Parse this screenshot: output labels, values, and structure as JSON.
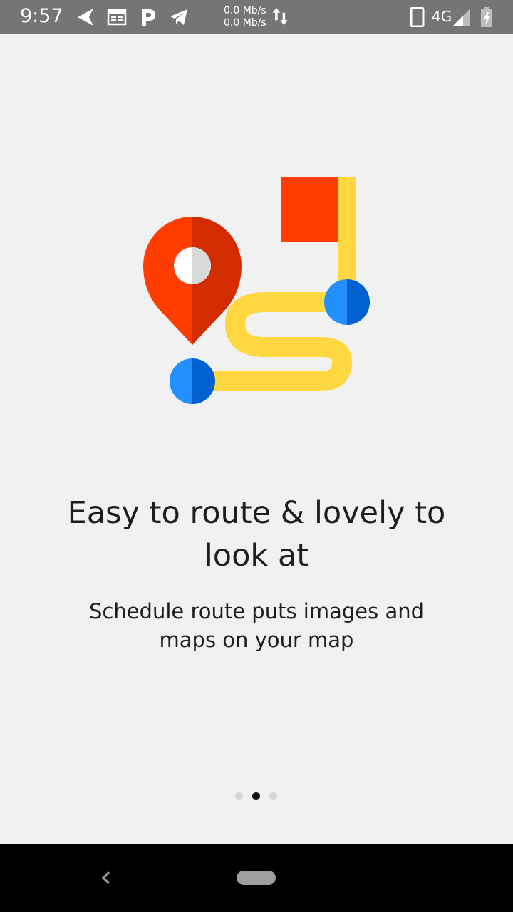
{
  "status_bar": {
    "time": "9:57",
    "net_up": "0.0 Mb/s",
    "net_down": "0.0 Mb/s",
    "network_type": "4G",
    "icons": [
      "navigation-arrow-icon",
      "calendar-icon",
      "parking-p-icon",
      "telegram-icon",
      "data-arrows-icon",
      "phone-device-icon",
      "signal-icon",
      "battery-charging-icon"
    ],
    "background_color": "#757575"
  },
  "onboarding": {
    "title": "Easy to route & lovely to look at",
    "subtitle": "Schedule route puts images and maps on your map",
    "illustration": "route-map-illustration",
    "colors": {
      "pin_red": "#ff3d00",
      "pin_dark_red": "#d32c00",
      "flag_red": "#ff3d00",
      "route_yellow": "#ffd740",
      "node_blue": "#2290ff",
      "node_dark_blue": "#0060d0"
    }
  },
  "pager": {
    "total": 3,
    "active_index": 1
  },
  "nav_bar": {
    "buttons": [
      "back-button",
      "home-button"
    ]
  }
}
